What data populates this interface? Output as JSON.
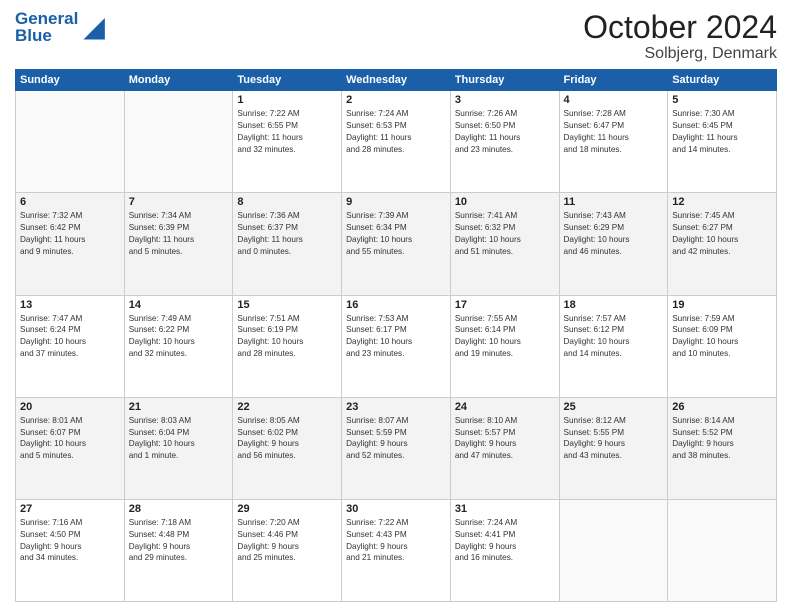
{
  "header": {
    "logo_line1": "General",
    "logo_line2": "Blue",
    "title": "October 2024",
    "subtitle": "Solbjerg, Denmark"
  },
  "weekdays": [
    "Sunday",
    "Monday",
    "Tuesday",
    "Wednesday",
    "Thursday",
    "Friday",
    "Saturday"
  ],
  "weeks": [
    [
      {
        "day": "",
        "info": ""
      },
      {
        "day": "",
        "info": ""
      },
      {
        "day": "1",
        "info": "Sunrise: 7:22 AM\nSunset: 6:55 PM\nDaylight: 11 hours\nand 32 minutes."
      },
      {
        "day": "2",
        "info": "Sunrise: 7:24 AM\nSunset: 6:53 PM\nDaylight: 11 hours\nand 28 minutes."
      },
      {
        "day": "3",
        "info": "Sunrise: 7:26 AM\nSunset: 6:50 PM\nDaylight: 11 hours\nand 23 minutes."
      },
      {
        "day": "4",
        "info": "Sunrise: 7:28 AM\nSunset: 6:47 PM\nDaylight: 11 hours\nand 18 minutes."
      },
      {
        "day": "5",
        "info": "Sunrise: 7:30 AM\nSunset: 6:45 PM\nDaylight: 11 hours\nand 14 minutes."
      }
    ],
    [
      {
        "day": "6",
        "info": "Sunrise: 7:32 AM\nSunset: 6:42 PM\nDaylight: 11 hours\nand 9 minutes."
      },
      {
        "day": "7",
        "info": "Sunrise: 7:34 AM\nSunset: 6:39 PM\nDaylight: 11 hours\nand 5 minutes."
      },
      {
        "day": "8",
        "info": "Sunrise: 7:36 AM\nSunset: 6:37 PM\nDaylight: 11 hours\nand 0 minutes."
      },
      {
        "day": "9",
        "info": "Sunrise: 7:39 AM\nSunset: 6:34 PM\nDaylight: 10 hours\nand 55 minutes."
      },
      {
        "day": "10",
        "info": "Sunrise: 7:41 AM\nSunset: 6:32 PM\nDaylight: 10 hours\nand 51 minutes."
      },
      {
        "day": "11",
        "info": "Sunrise: 7:43 AM\nSunset: 6:29 PM\nDaylight: 10 hours\nand 46 minutes."
      },
      {
        "day": "12",
        "info": "Sunrise: 7:45 AM\nSunset: 6:27 PM\nDaylight: 10 hours\nand 42 minutes."
      }
    ],
    [
      {
        "day": "13",
        "info": "Sunrise: 7:47 AM\nSunset: 6:24 PM\nDaylight: 10 hours\nand 37 minutes."
      },
      {
        "day": "14",
        "info": "Sunrise: 7:49 AM\nSunset: 6:22 PM\nDaylight: 10 hours\nand 32 minutes."
      },
      {
        "day": "15",
        "info": "Sunrise: 7:51 AM\nSunset: 6:19 PM\nDaylight: 10 hours\nand 28 minutes."
      },
      {
        "day": "16",
        "info": "Sunrise: 7:53 AM\nSunset: 6:17 PM\nDaylight: 10 hours\nand 23 minutes."
      },
      {
        "day": "17",
        "info": "Sunrise: 7:55 AM\nSunset: 6:14 PM\nDaylight: 10 hours\nand 19 minutes."
      },
      {
        "day": "18",
        "info": "Sunrise: 7:57 AM\nSunset: 6:12 PM\nDaylight: 10 hours\nand 14 minutes."
      },
      {
        "day": "19",
        "info": "Sunrise: 7:59 AM\nSunset: 6:09 PM\nDaylight: 10 hours\nand 10 minutes."
      }
    ],
    [
      {
        "day": "20",
        "info": "Sunrise: 8:01 AM\nSunset: 6:07 PM\nDaylight: 10 hours\nand 5 minutes."
      },
      {
        "day": "21",
        "info": "Sunrise: 8:03 AM\nSunset: 6:04 PM\nDaylight: 10 hours\nand 1 minute."
      },
      {
        "day": "22",
        "info": "Sunrise: 8:05 AM\nSunset: 6:02 PM\nDaylight: 9 hours\nand 56 minutes."
      },
      {
        "day": "23",
        "info": "Sunrise: 8:07 AM\nSunset: 5:59 PM\nDaylight: 9 hours\nand 52 minutes."
      },
      {
        "day": "24",
        "info": "Sunrise: 8:10 AM\nSunset: 5:57 PM\nDaylight: 9 hours\nand 47 minutes."
      },
      {
        "day": "25",
        "info": "Sunrise: 8:12 AM\nSunset: 5:55 PM\nDaylight: 9 hours\nand 43 minutes."
      },
      {
        "day": "26",
        "info": "Sunrise: 8:14 AM\nSunset: 5:52 PM\nDaylight: 9 hours\nand 38 minutes."
      }
    ],
    [
      {
        "day": "27",
        "info": "Sunrise: 7:16 AM\nSunset: 4:50 PM\nDaylight: 9 hours\nand 34 minutes."
      },
      {
        "day": "28",
        "info": "Sunrise: 7:18 AM\nSunset: 4:48 PM\nDaylight: 9 hours\nand 29 minutes."
      },
      {
        "day": "29",
        "info": "Sunrise: 7:20 AM\nSunset: 4:46 PM\nDaylight: 9 hours\nand 25 minutes."
      },
      {
        "day": "30",
        "info": "Sunrise: 7:22 AM\nSunset: 4:43 PM\nDaylight: 9 hours\nand 21 minutes."
      },
      {
        "day": "31",
        "info": "Sunrise: 7:24 AM\nSunset: 4:41 PM\nDaylight: 9 hours\nand 16 minutes."
      },
      {
        "day": "",
        "info": ""
      },
      {
        "day": "",
        "info": ""
      }
    ]
  ],
  "shaded_rows": [
    1,
    3
  ]
}
